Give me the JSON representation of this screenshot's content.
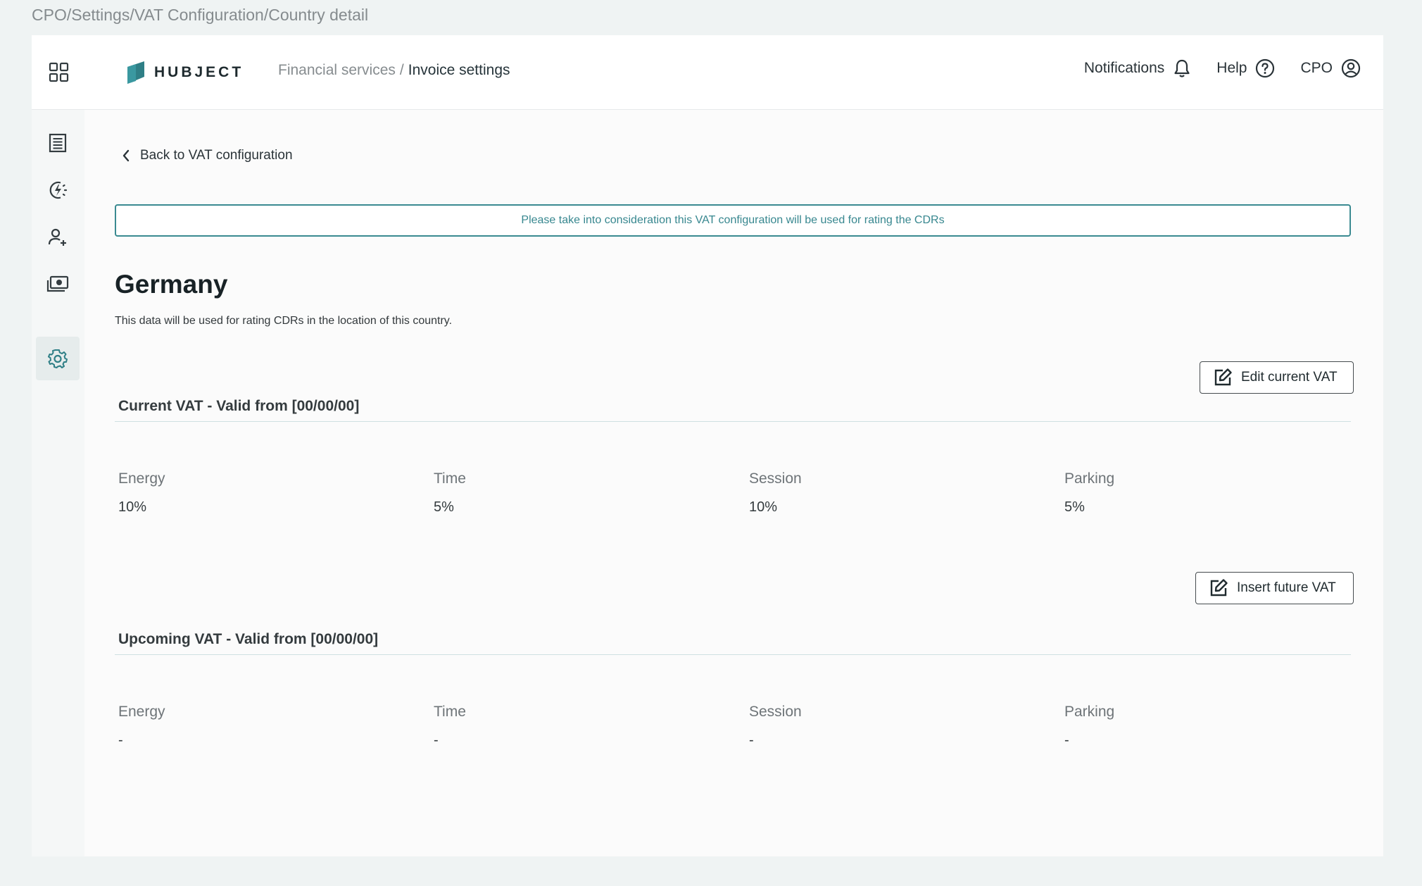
{
  "frame": {
    "title": "CPO/Settings/VAT Configuration/Country detail"
  },
  "header": {
    "logo_text": "HUBJECT",
    "breadcrumb": {
      "parent": "Financial services",
      "separator": "/",
      "current": "Invoice settings"
    },
    "notifications_label": "Notifications",
    "help_label": "Help",
    "user_label": "CPO"
  },
  "sidebar": {
    "items": [
      {
        "icon": "list-icon"
      },
      {
        "icon": "charging-icon"
      },
      {
        "icon": "add-user-icon"
      },
      {
        "icon": "money-icon"
      },
      {
        "icon": "gear-icon",
        "active": true
      }
    ]
  },
  "main": {
    "back_label": "Back to VAT configuration",
    "notice": "Please take into consideration this VAT configuration will be used for rating the CDRs",
    "country": "Germany",
    "description": "This data will be used for rating CDRs in the location of this country.",
    "edit_button": "Edit current VAT",
    "insert_button": "Insert future VAT",
    "current": {
      "title": "Current VAT - Valid from [00/00/00]",
      "columns": [
        {
          "label": "Energy",
          "value": "10%"
        },
        {
          "label": "Time",
          "value": "5%"
        },
        {
          "label": "Session",
          "value": "10%"
        },
        {
          "label": "Parking",
          "value": "5%"
        }
      ]
    },
    "upcoming": {
      "title": "Upcoming VAT - Valid from [00/00/00]",
      "columns": [
        {
          "label": "Energy",
          "value": "-"
        },
        {
          "label": "Time",
          "value": "-"
        },
        {
          "label": "Session",
          "value": "-"
        },
        {
          "label": "Parking",
          "value": "-"
        }
      ]
    }
  },
  "colors": {
    "accent": "#37878f",
    "brand": "#2f7f86",
    "background": "#eff3f3"
  }
}
